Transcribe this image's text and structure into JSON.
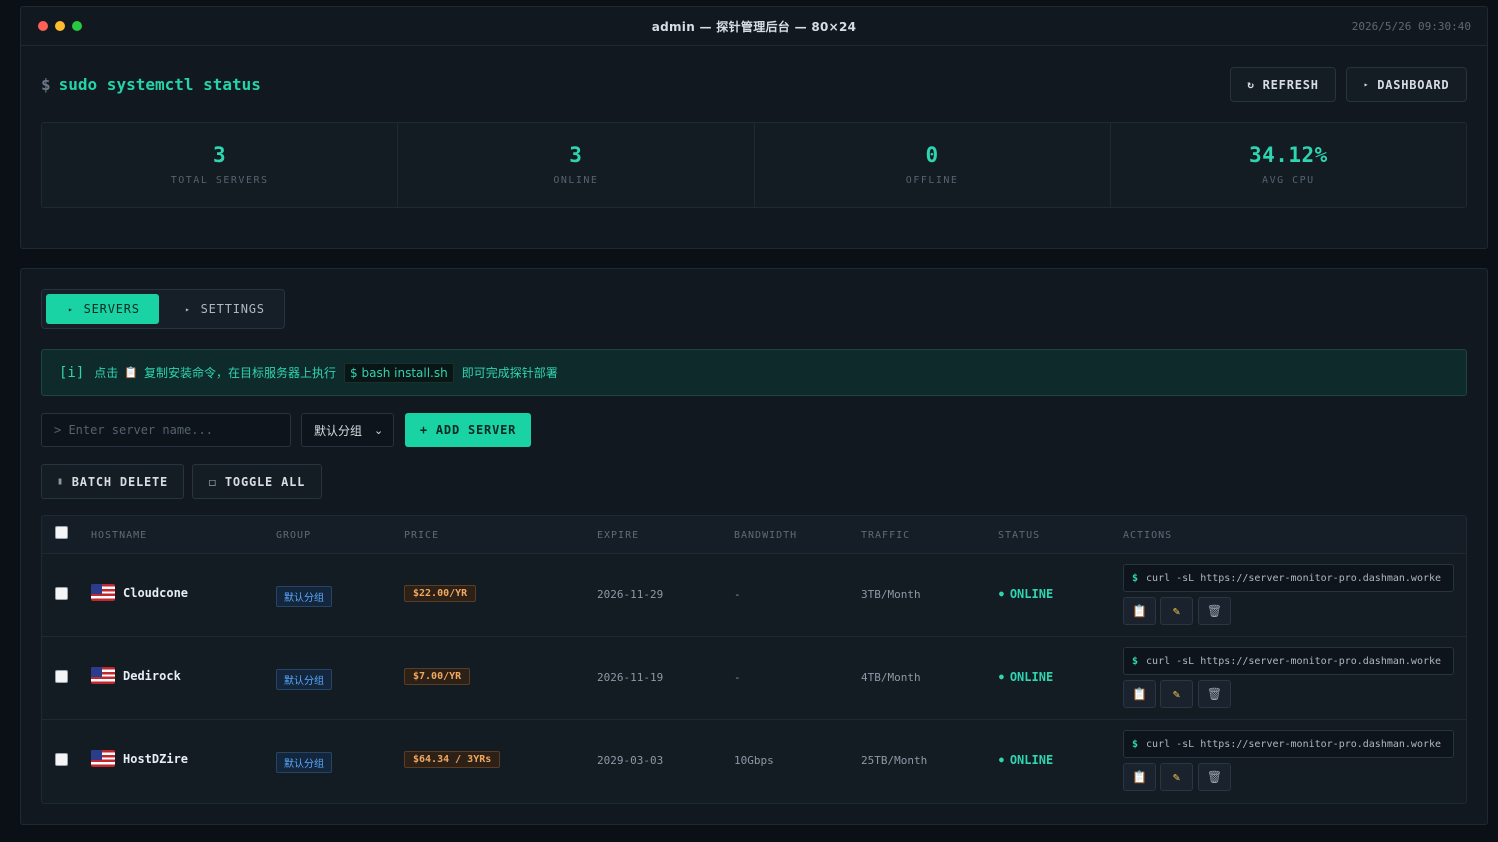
{
  "window": {
    "title": "admin — 探针管理后台 — 80×24",
    "clock": "2026/5/26 09:30:40"
  },
  "header": {
    "prompt": "$",
    "command": "sudo systemctl status",
    "refresh_label": "REFRESH",
    "refresh_icon": "↻",
    "dashboard_label": "DASHBOARD",
    "dashboard_icon": "▸"
  },
  "stats": [
    {
      "value": "3",
      "label": "TOTAL SERVERS"
    },
    {
      "value": "3",
      "label": "ONLINE"
    },
    {
      "value": "0",
      "label": "OFFLINE"
    },
    {
      "value": "34.12%",
      "label": "AVG CPU"
    }
  ],
  "tabs": [
    {
      "label": "SERVERS",
      "icon": "▸",
      "active": true
    },
    {
      "label": "SETTINGS",
      "icon": "▸",
      "active": false
    }
  ],
  "info": {
    "tag": "[i]",
    "text_before": "点击",
    "clip_icon": "📋",
    "text_middle": "复制安装命令，在目标服务器上执行",
    "code": "$ bash install.sh",
    "text_after": "即可完成探针部署"
  },
  "toolbar": {
    "search_placeholder": "> Enter server name...",
    "group_value": "默认分组",
    "add_label": "+ ADD SERVER",
    "batch_delete_label": "BATCH DELETE",
    "batch_delete_icon": "▮",
    "toggle_all_label": "TOGGLE ALL",
    "toggle_all_icon": "☐"
  },
  "table": {
    "headers": [
      "HOSTNAME",
      "GROUP",
      "PRICE",
      "EXPIRE",
      "BANDWIDTH",
      "TRAFFIC",
      "STATUS",
      "ACTIONS"
    ],
    "rows": [
      {
        "hostname": "Cloudcone",
        "group": "默认分组",
        "price": "$22.00/YR",
        "expire": "2026-11-29",
        "bandwidth": "-",
        "traffic": "3TB/Month",
        "status": "ONLINE",
        "install_cmd": "curl -sL https://server-monitor-pro.dashman.worke"
      },
      {
        "hostname": "Dedirock",
        "group": "默认分组",
        "price": "$7.00/YR",
        "expire": "2026-11-19",
        "bandwidth": "-",
        "traffic": "4TB/Month",
        "status": "ONLINE",
        "install_cmd": "curl -sL https://server-monitor-pro.dashman.worke"
      },
      {
        "hostname": "HostDZire",
        "group": "默认分组",
        "price": "$64.34 / 3YRs",
        "expire": "2029-03-03",
        "bandwidth": "10Gbps",
        "traffic": "25TB/Month",
        "status": "ONLINE",
        "install_cmd": "curl -sL https://server-monitor-pro.dashman.worke"
      }
    ],
    "status_bullet": "●",
    "cmd_prompt": "$"
  },
  "colors": {
    "accent": "#19d3a5",
    "background": "#0b1016",
    "panel": "#111820",
    "price": "#f0a860",
    "group": "#5aa8ff"
  }
}
